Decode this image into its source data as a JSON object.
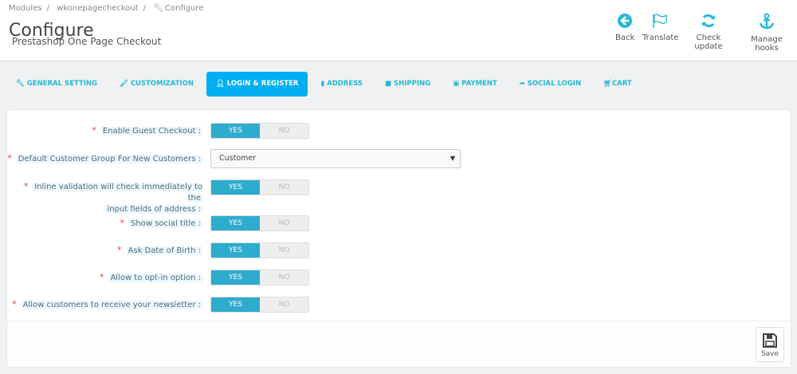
{
  "breadcrumb": [
    "Modules",
    "wkonepagecheckout",
    "Configure"
  ],
  "header": {
    "title": "Configure",
    "subtitle": "Prestashop One Page Checkout"
  },
  "toolbar": {
    "back": "Back",
    "translate": "Translate",
    "check_update": "Check update",
    "manage_hooks": "Manage hooks"
  },
  "tabs": [
    {
      "label": "GENERAL SETTING"
    },
    {
      "label": "CUSTOMIZATION"
    },
    {
      "label": "LOGIN & REGISTER",
      "active": true
    },
    {
      "label": "ADDRESS"
    },
    {
      "label": "SHIPPING"
    },
    {
      "label": "PAYMENT"
    },
    {
      "label": "SOCIAL LOGIN"
    },
    {
      "label": "CART"
    }
  ],
  "form": {
    "yes": "YES",
    "no": "NO",
    "required": "*",
    "fields": [
      {
        "label": "Enable Guest Checkout :",
        "value": "YES"
      },
      {
        "label": "Default Customer Group For New Customers :",
        "value": "Customer"
      },
      {
        "label1": "Inline validation will check immediately to the",
        "label2": "input fields of address :",
        "value": "YES"
      },
      {
        "label": "Show social title :",
        "value": "YES"
      },
      {
        "label": "Ask Date of Birth :",
        "value": "YES"
      },
      {
        "label": "Allow to opt-in option :",
        "value": "YES"
      },
      {
        "label": "Allow customers to receive your newsletter :",
        "value": "YES"
      }
    ]
  },
  "save_label": "Save",
  "colors": {
    "accent": "#25b9d7",
    "active_tab": "#00aff0",
    "toggle_on": "#2eacce"
  }
}
